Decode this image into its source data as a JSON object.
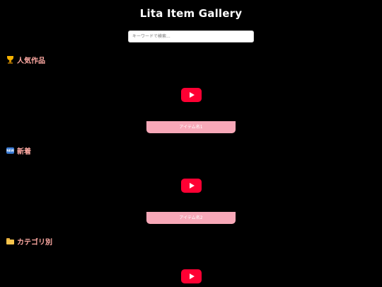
{
  "site": {
    "title": "Lita Item Gallery"
  },
  "search": {
    "placeholder": "キーワードで検索...",
    "value": ""
  },
  "sections": [
    {
      "title": "人気作品",
      "icon": "trophy-icon",
      "item_label": "アイテム名1"
    },
    {
      "title": "新着",
      "icon": "new-badge-icon",
      "item_label": "アイテム名2"
    },
    {
      "title": "カテゴリ別",
      "icon": "folder-icon"
    }
  ],
  "colors": {
    "background": "#000000",
    "heading": "#ffaaa3",
    "play_button": "#ff0033",
    "item_label_bg": "#f8a8b8"
  }
}
